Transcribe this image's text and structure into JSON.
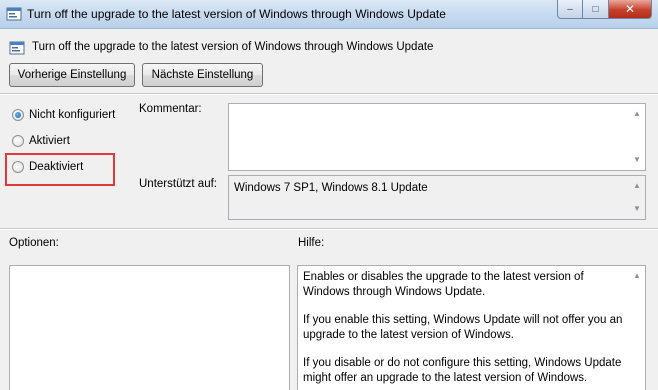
{
  "window": {
    "title": "Turn off the upgrade to the latest version of Windows through Windows Update",
    "controls": {
      "minimize": "–",
      "maximize": "□",
      "close": "✕"
    }
  },
  "header": {
    "policy_title": "Turn off the upgrade to the latest version of Windows through Windows Update",
    "prev_button": "Vorherige Einstellung",
    "next_button": "Nächste Einstellung"
  },
  "state": {
    "options": [
      {
        "label": "Nicht konfiguriert",
        "checked": true
      },
      {
        "label": "Aktiviert",
        "checked": false
      },
      {
        "label": "Deaktiviert",
        "checked": false
      }
    ]
  },
  "comment": {
    "label": "Kommentar:",
    "value": ""
  },
  "supported": {
    "label": "Unterstützt auf:",
    "value": "Windows 7 SP1, Windows 8.1 Update"
  },
  "options_section": {
    "label": "Optionen:"
  },
  "help_section": {
    "label": "Hilfe:",
    "paragraphs": [
      "Enables or disables the upgrade to the latest version of Windows through Windows Update.",
      "If you enable this setting, Windows Update will not offer you an upgrade to the latest version of Windows.",
      "If you disable or do not configure this setting, Windows Update might offer an upgrade to the latest version of Windows."
    ]
  },
  "colors": {
    "highlight": "#e03a3a",
    "titlebar": "#c9dcf0"
  }
}
